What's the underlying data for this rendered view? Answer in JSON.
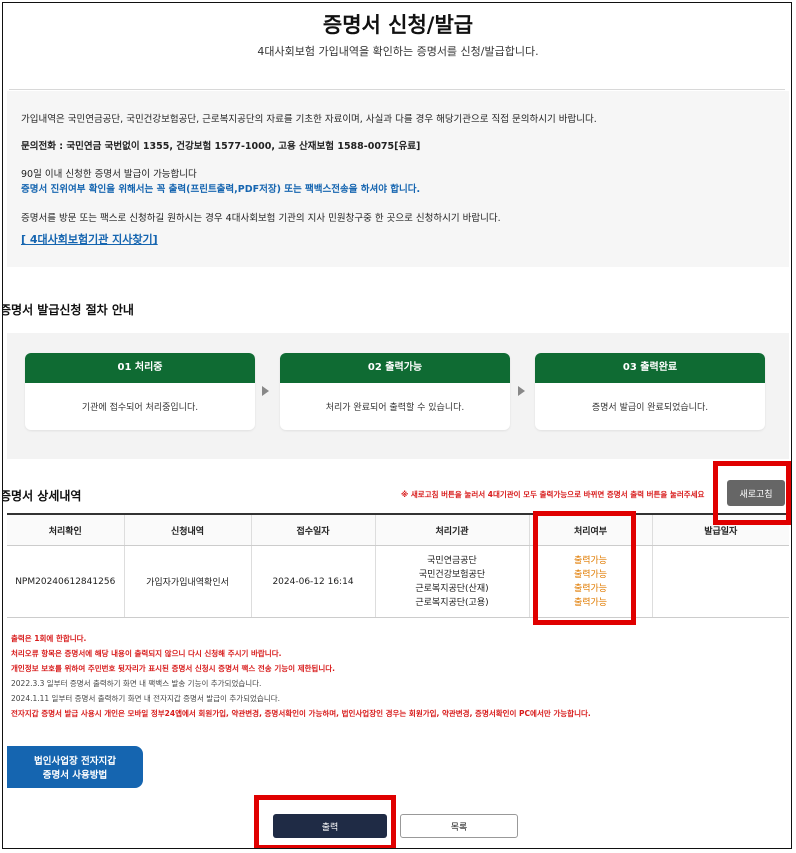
{
  "header": {
    "title": "증명서 신청/발급",
    "subtitle": "4대사회보험 가입내역을 확인하는 증명서를 신청/발급합니다."
  },
  "info": {
    "line1": "가입내역은 국민연금공단, 국민건강보험공단, 근로복지공단의 자료를 기초한 자료이며, 사실과 다를 경우 해당기관으로 직접 문의하시기 바랍니다.",
    "line2": "문의전화 : 국민연금 국번없이 1355, 건강보험 1577-1000, 고용 산재보험 1588-0075[유료]",
    "line3": "90일 이내 신청한 증명서 발급이 가능합니다",
    "line4": "증명서 진위여부 확인을 위해서는 꼭 출력(프린트출력,PDF저장) 또는 팩백스전송을 하셔야 합니다.",
    "line5": "증명서를 방문 또는 팩스로 신청하길 원하시는 경우 4대사회보험 기관의 지사 민원창구중 한 곳으로 신청하시기 바랍니다.",
    "link": "[ 4대사회보험기관 지사찾기]"
  },
  "procedure": {
    "title": "증명서 발급신청 절차 안내",
    "steps": [
      {
        "title": "01 처리중",
        "desc": "기관에 접수되어 처리중입니다."
      },
      {
        "title": "02 출력가능",
        "desc": "처리가 완료되어 출력할 수 있습니다."
      },
      {
        "title": "03 출력완료",
        "desc": "증명서 발급이 완료되었습니다."
      }
    ]
  },
  "detail": {
    "title": "증명서 상세내역",
    "notice": "※ 새로고침 버튼을 눌러서 4대기관이 모두 출력가능으로 바뀌면 증명서 출력 버튼을 눌러주세요",
    "refresh_label": "새로고침",
    "columns": [
      "처리확인",
      "신청내역",
      "접수일자",
      "처리기관",
      "처리여부",
      "발급일자"
    ],
    "row": {
      "id": "NPM20240612841256",
      "type": "가입자가입내역확인서",
      "date": "2024-06-12 16:14",
      "agencies": [
        "국민연금공단",
        "국민건강보험공단",
        "근로복지공단(산재)",
        "근로복지공단(고용)"
      ],
      "statuses": [
        "출력가능",
        "출력가능",
        "출력가능",
        "출력가능"
      ],
      "issue_date": ""
    }
  },
  "notes": [
    "출력은 1회에 한합니다.",
    "처리오류 항목은 증명서에 해당 내용이 출력되지 않으니 다시 신청해 주시기 바랍니다.",
    "개인정보 보호를 위하여 주민번호 뒷자리가 표시된 증명서 신청시 증명서 팩스 전송 기능이 제한됩니다.",
    "2022.3.3 일부터 증명서 출력하기 화면 내 팩백스 발송 기능이 추가되었습니다.",
    "2024.1.11 일부터 증명서 출력하기 화면 내 전자지갑 증명서 발급이 추가되었습니다.",
    "전자지갑 증명서 발급 사용시 개인은 모바일 정부24앱에서 회원가입, 약관변경, 증명서확인이 가능하며, 법인사업장인 경우는 회원가입, 약관변경, 증명서확인이 PC에서만 가능합니다."
  ],
  "buttons": {
    "guide_line1": "법인사업장 전자지갑",
    "guide_line2": "증명서 사용방법",
    "print": "출력",
    "list": "목록"
  },
  "colors": {
    "step_header": "#0f6b33",
    "link_blue": "#1565b0",
    "notice_red": "#d81b1b",
    "status_orange": "#e07b00",
    "highlight_red": "#e00000",
    "print_button": "#1f2b45"
  }
}
